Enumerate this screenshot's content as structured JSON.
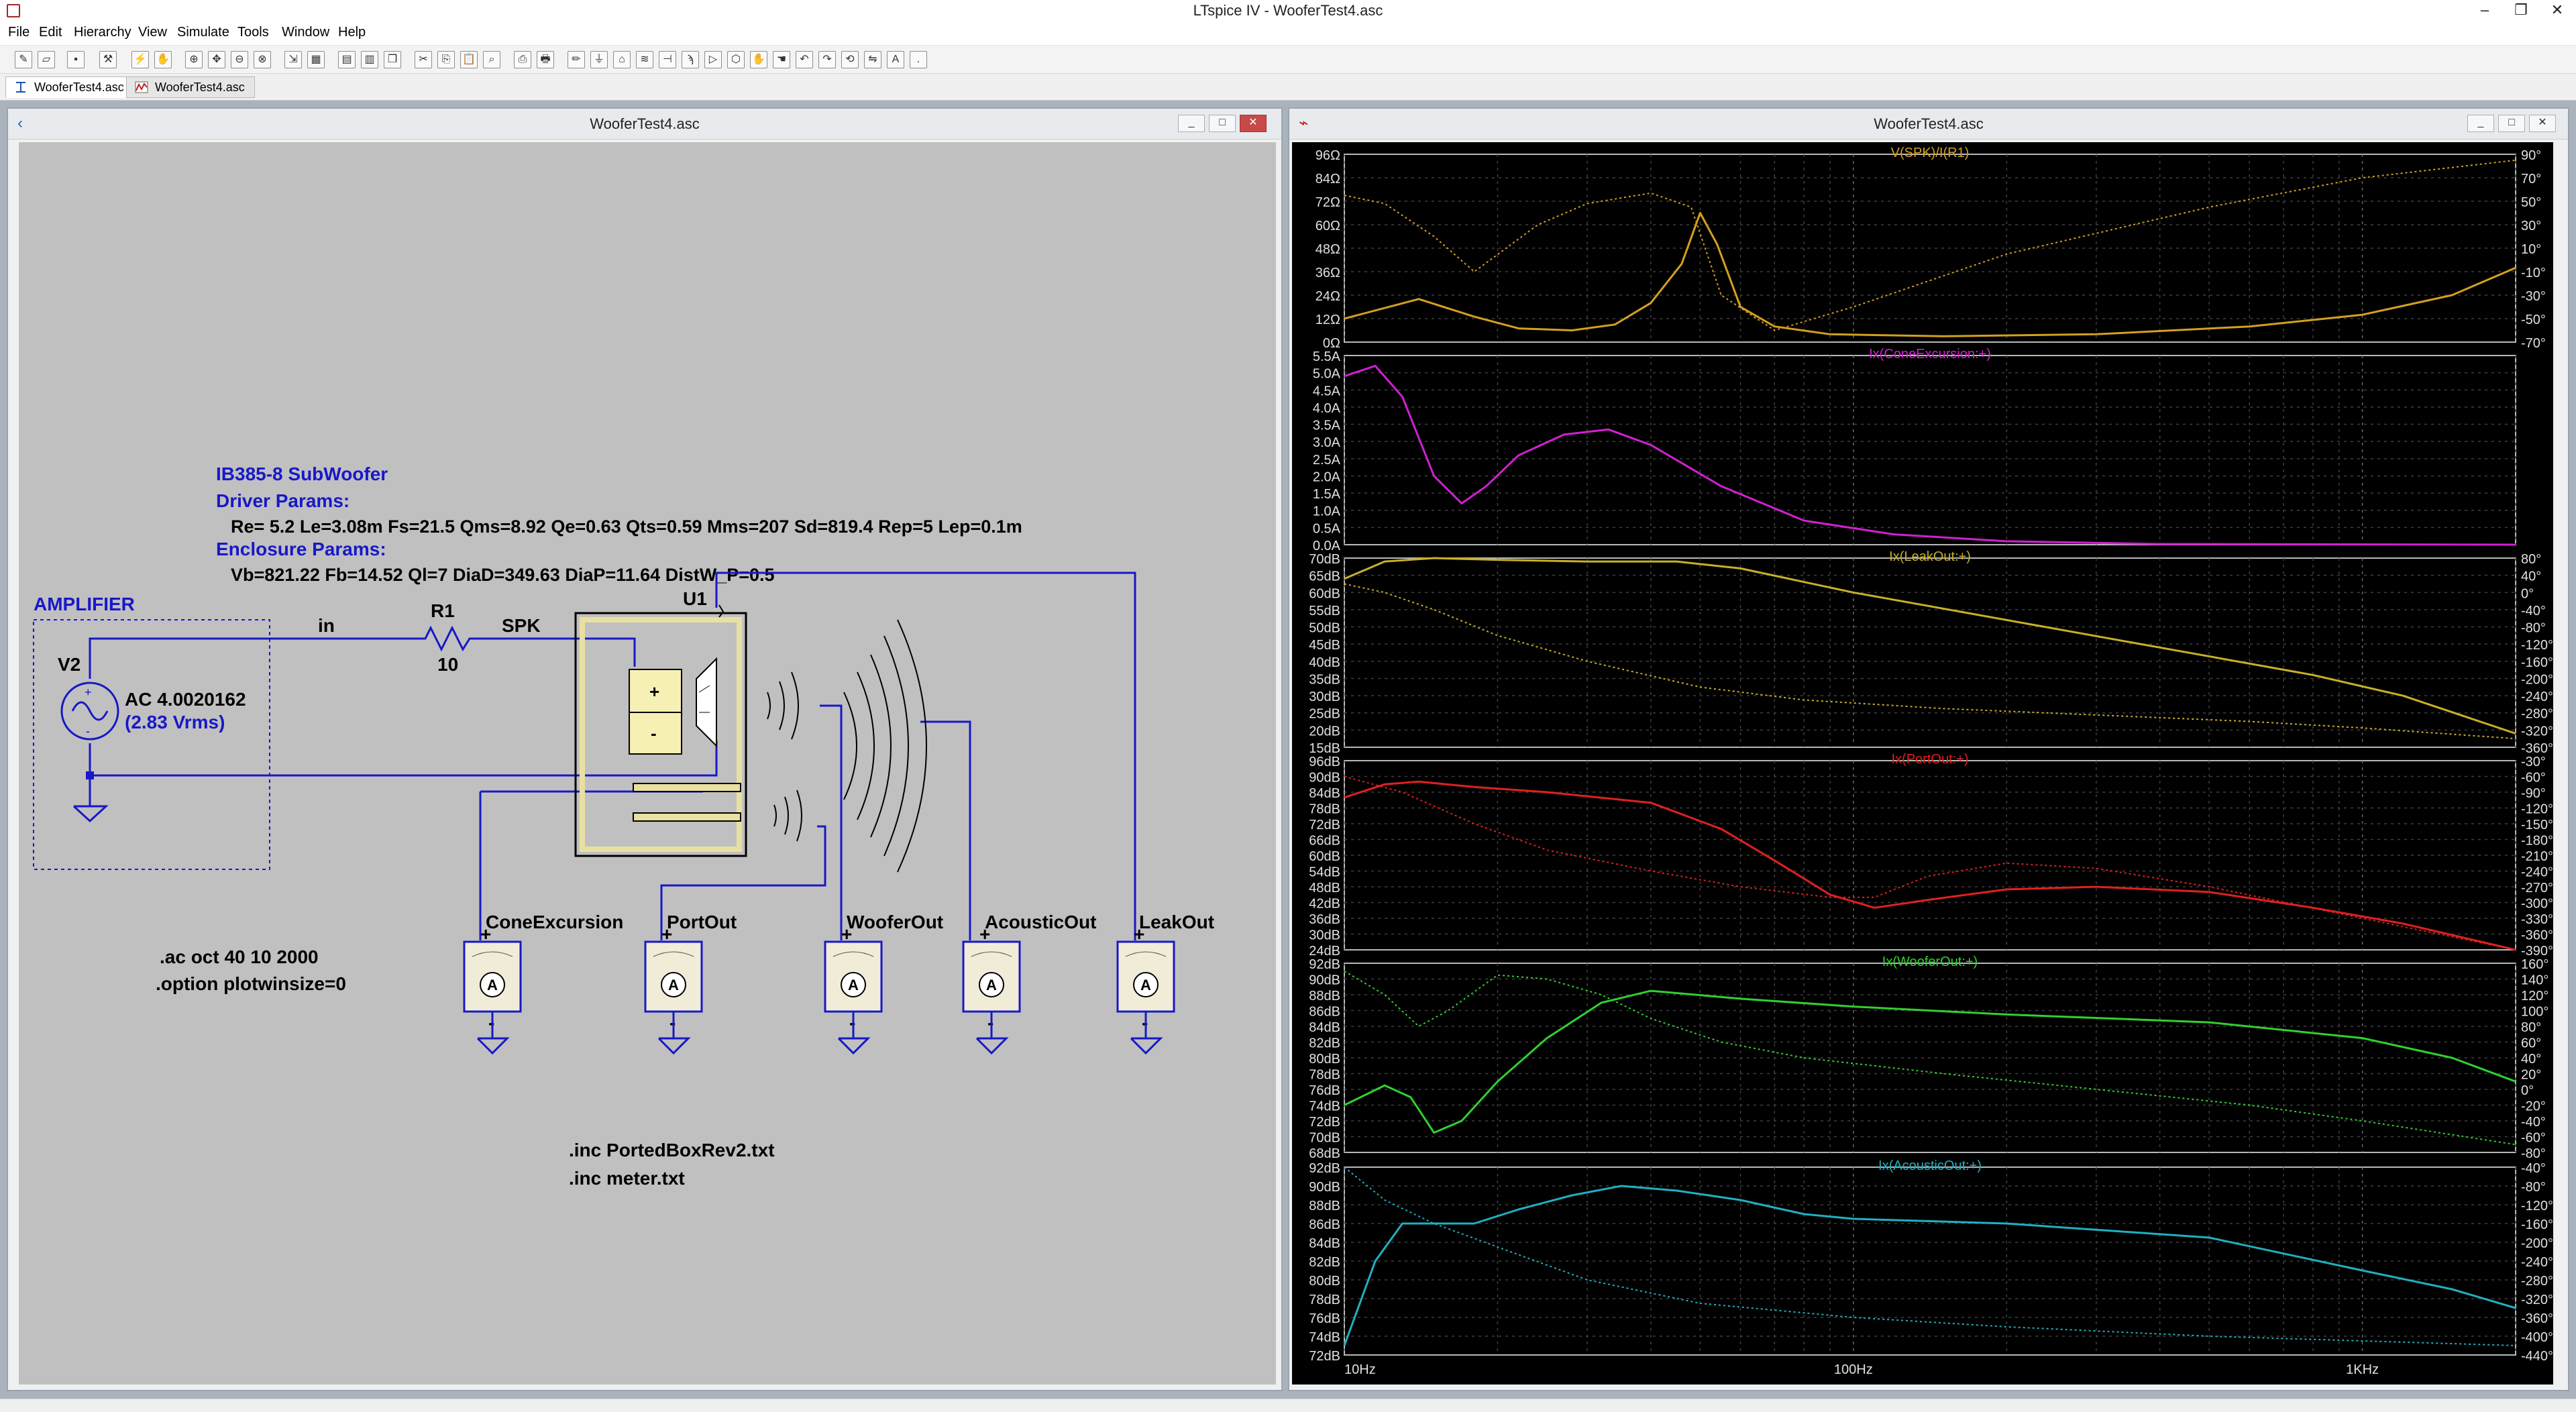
{
  "window": {
    "title": "LTspice IV - WooferTest4.asc",
    "minimize": "–",
    "restore": "❐",
    "close": "✕"
  },
  "menu": [
    "File",
    "Edit",
    "Hierarchy",
    "View",
    "Simulate",
    "Tools",
    "Window",
    "Help"
  ],
  "tabs": [
    {
      "label": "WooferTest4.asc",
      "icon": "schematic-icon",
      "active": true
    },
    {
      "label": "WooferTest4.asc",
      "icon": "waveform-icon",
      "active": false
    }
  ],
  "schematic_window": {
    "title": "WooferTest4.asc",
    "controls": {
      "min": "_",
      "max": "□",
      "close": "✕"
    },
    "texts": {
      "heading": "IB385-8 SubWoofer",
      "driver_params_label": "Driver Params:",
      "driver_params": "Re= 5.2 Le=3.08m  Fs=21.5 Qms=8.92 Qe=0.63 Qts=0.59 Mms=207 Sd=819.4 Rep=5 Lep=0.1m",
      "enclosure_params_label": "Enclosure Params:",
      "enclosure_params": "Vb=821.22 Fb=14.52 Ql=7 DiaD=349.63 DiaP=11.64 DistW_P=0.5",
      "amplifier": "AMPLIFIER",
      "source_name": "V2",
      "source_value": "AC 4.0020162",
      "source_rms": "(2.83 Vrms)",
      "net_in": "in",
      "net_spk": "SPK",
      "r1_name": "R1",
      "r1_value": "10",
      "u1_name": "U1",
      "plus": "+",
      "minus": "-",
      "meters": [
        "ConeExcursion",
        "PortOut",
        "WooferOut",
        "AcousticOut",
        "LeakOut"
      ],
      "meter_symbol": "A",
      "directive_ac": ".ac oct 40 10 2000",
      "directive_option": ".option plotwinsize=0",
      "inc1": ".inc PortedBoxRev2.txt",
      "inc2": ".inc meter.txt"
    }
  },
  "plot_window": {
    "title": "WooferTest4.asc",
    "controls": {
      "min": "_",
      "max": "□",
      "close": "✕"
    },
    "x_ticks": [
      "10Hz",
      "100Hz",
      "1KHz"
    ]
  },
  "chart_data": [
    {
      "type": "line",
      "title": "V(SPK)/I(R1)",
      "color": "#d4a020",
      "x_scale": "log",
      "x_range_hz": [
        10,
        2000
      ],
      "left_ticks": [
        "96Ω",
        "84Ω",
        "72Ω",
        "60Ω",
        "48Ω",
        "36Ω",
        "24Ω",
        "12Ω",
        "0Ω"
      ],
      "right_ticks": [
        "90°",
        "70°",
        "50°",
        "30°",
        "10°",
        "-10°",
        "-30°",
        "-50°",
        "-70°"
      ],
      "ylim": [
        0,
        96
      ],
      "phase_lim": [
        -70,
        90
      ],
      "series": [
        {
          "label": "magnitude",
          "style": "solid",
          "x": [
            10,
            14,
            18,
            22,
            28,
            34,
            40,
            46,
            50,
            54,
            60,
            70,
            90,
            150,
            300,
            600,
            1000,
            1500,
            2000
          ],
          "y": [
            12,
            22,
            13,
            7,
            6,
            9,
            20,
            40,
            66,
            50,
            18,
            8,
            4,
            3,
            4,
            8,
            14,
            24,
            38
          ]
        },
        {
          "label": "phase",
          "style": "dotted",
          "x": [
            10,
            12,
            15,
            18,
            24,
            30,
            40,
            48,
            55,
            70,
            100,
            200,
            500,
            1000,
            2000
          ],
          "y": [
            55,
            48,
            20,
            -10,
            30,
            48,
            57,
            45,
            -30,
            -60,
            -40,
            5,
            45,
            70,
            85
          ]
        }
      ]
    },
    {
      "type": "line",
      "title": "Ix(ConeExcursion:+)",
      "color": "#d020d0",
      "x_scale": "log",
      "x_range_hz": [
        10,
        2000
      ],
      "left_ticks": [
        "5.5A",
        "5.0A",
        "4.5A",
        "4.0A",
        "3.5A",
        "3.0A",
        "2.5A",
        "2.0A",
        "1.5A",
        "1.0A",
        "0.5A",
        "0.0A"
      ],
      "ylim": [
        0,
        5.5
      ],
      "series": [
        {
          "label": "magnitude",
          "style": "solid",
          "x": [
            10,
            11.5,
            13,
            15,
            17,
            19,
            22,
            27,
            33,
            40,
            55,
            80,
            120,
            200,
            400,
            2000
          ],
          "y": [
            4.9,
            5.2,
            4.3,
            2.0,
            1.2,
            1.7,
            2.6,
            3.2,
            3.35,
            2.9,
            1.7,
            0.7,
            0.3,
            0.1,
            0.02,
            0.0
          ]
        }
      ]
    },
    {
      "type": "line",
      "title": "Ix(LeakOut:+)",
      "color": "#c8b028",
      "x_scale": "log",
      "x_range_hz": [
        10,
        2000
      ],
      "left_ticks": [
        "70dB",
        "65dB",
        "60dB",
        "55dB",
        "50dB",
        "45dB",
        "40dB",
        "35dB",
        "30dB",
        "25dB",
        "20dB",
        "15dB"
      ],
      "right_ticks": [
        "80°",
        "40°",
        "0°",
        "-40°",
        "-80°",
        "-120°",
        "-160°",
        "-200°",
        "-240°",
        "-280°",
        "-320°",
        "-360°"
      ],
      "ylim": [
        15,
        70
      ],
      "phase_lim": [
        -360,
        80
      ],
      "series": [
        {
          "label": "magnitude",
          "style": "solid",
          "x": [
            10,
            12,
            15,
            20,
            30,
            45,
            60,
            100,
            200,
            400,
            800,
            1200,
            2000
          ],
          "y": [
            64,
            69,
            70,
            69.5,
            69,
            69,
            67,
            60,
            52,
            44,
            36,
            30,
            19
          ]
        },
        {
          "label": "phase",
          "style": "dotted",
          "x": [
            10,
            12,
            15,
            20,
            30,
            50,
            80,
            150,
            300,
            600,
            1000,
            2000
          ],
          "y": [
            20,
            0,
            -40,
            -100,
            -160,
            -220,
            -250,
            -270,
            -285,
            -300,
            -315,
            -340
          ]
        }
      ]
    },
    {
      "type": "line",
      "title": "Ix(PortOut:+)",
      "color": "#e02020",
      "x_scale": "log",
      "x_range_hz": [
        10,
        2000
      ],
      "left_ticks": [
        "96dB",
        "90dB",
        "84dB",
        "78dB",
        "72dB",
        "66dB",
        "60dB",
        "54dB",
        "48dB",
        "42dB",
        "36dB",
        "30dB",
        "24dB"
      ],
      "right_ticks": [
        "-30°",
        "-60°",
        "-90°",
        "-120°",
        "-150°",
        "-180°",
        "-210°",
        "-240°",
        "-270°",
        "-300°",
        "-330°",
        "-360°",
        "-390°"
      ],
      "ylim": [
        24,
        96
      ],
      "phase_lim": [
        -390,
        -30
      ],
      "series": [
        {
          "label": "magnitude",
          "style": "solid",
          "x": [
            10,
            12,
            14,
            18,
            25,
            40,
            55,
            70,
            90,
            110,
            140,
            200,
            300,
            500,
            800,
            1200,
            2000
          ],
          "y": [
            82,
            87,
            88,
            86,
            84,
            80,
            70,
            58,
            45,
            40,
            43,
            47,
            48,
            46,
            40,
            34,
            24
          ]
        },
        {
          "label": "phase",
          "style": "dotted",
          "x": [
            10,
            13,
            18,
            25,
            40,
            60,
            90,
            110,
            140,
            200,
            300,
            500,
            1000,
            2000
          ],
          "y": [
            -60,
            -90,
            -150,
            -200,
            -240,
            -270,
            -290,
            -290,
            -250,
            -225,
            -235,
            -270,
            -330,
            -390
          ]
        }
      ]
    },
    {
      "type": "line",
      "title": "Ix(WooferOut:+)",
      "color": "#30d030",
      "x_scale": "log",
      "x_range_hz": [
        10,
        2000
      ],
      "left_ticks": [
        "92dB",
        "90dB",
        "88dB",
        "86dB",
        "84dB",
        "82dB",
        "80dB",
        "78dB",
        "76dB",
        "74dB",
        "72dB",
        "70dB",
        "68dB"
      ],
      "right_ticks": [
        "160°",
        "140°",
        "120°",
        "100°",
        "80°",
        "60°",
        "40°",
        "20°",
        "0°",
        "-20°",
        "-40°",
        "-60°",
        "-80°"
      ],
      "ylim": [
        68,
        92
      ],
      "phase_lim": [
        -80,
        160
      ],
      "series": [
        {
          "label": "magnitude",
          "style": "solid",
          "x": [
            10,
            12,
            13.5,
            15,
            17,
            20,
            25,
            32,
            40,
            60,
            100,
            200,
            500,
            1000,
            1500,
            2000
          ],
          "y": [
            74,
            76.5,
            75,
            70.5,
            72,
            77,
            82.5,
            87,
            88.5,
            87.5,
            86.5,
            85.5,
            84.5,
            82.5,
            80,
            77
          ]
        },
        {
          "label": "phase",
          "style": "dotted",
          "x": [
            10,
            12,
            14,
            16,
            20,
            25,
            32,
            40,
            55,
            80,
            150,
            300,
            600,
            1000,
            2000
          ],
          "y": [
            150,
            120,
            80,
            100,
            145,
            140,
            120,
            90,
            60,
            40,
            20,
            0,
            -20,
            -40,
            -70
          ]
        }
      ]
    },
    {
      "type": "line",
      "title": "Ix(AcousticOut:+)",
      "color": "#20b0c0",
      "x_scale": "log",
      "x_range_hz": [
        10,
        2000
      ],
      "left_ticks": [
        "92dB",
        "90dB",
        "88dB",
        "86dB",
        "84dB",
        "82dB",
        "80dB",
        "78dB",
        "76dB",
        "74dB",
        "72dB"
      ],
      "right_ticks": [
        "-40°",
        "-80°",
        "-120°",
        "-160°",
        "-200°",
        "-240°",
        "-280°",
        "-320°",
        "-360°",
        "-400°",
        "-440°"
      ],
      "ylim": [
        72,
        92
      ],
      "phase_lim": [
        -440,
        -40
      ],
      "series": [
        {
          "label": "magnitude",
          "style": "solid",
          "x": [
            10,
            11.5,
            13,
            15,
            18,
            22,
            28,
            35,
            45,
            60,
            80,
            100,
            200,
            500,
            1000,
            1500,
            2000
          ],
          "y": [
            73,
            82,
            86,
            86,
            86,
            87.5,
            89,
            90,
            89.5,
            88.5,
            87,
            86.5,
            86,
            84.5,
            81,
            79,
            77
          ]
        },
        {
          "label": "phase",
          "style": "dotted",
          "x": [
            10,
            12,
            15,
            20,
            30,
            50,
            100,
            200,
            500,
            1000,
            2000
          ],
          "y": [
            -40,
            -110,
            -160,
            -210,
            -280,
            -330,
            -360,
            -380,
            -400,
            -410,
            -420
          ]
        }
      ]
    }
  ]
}
